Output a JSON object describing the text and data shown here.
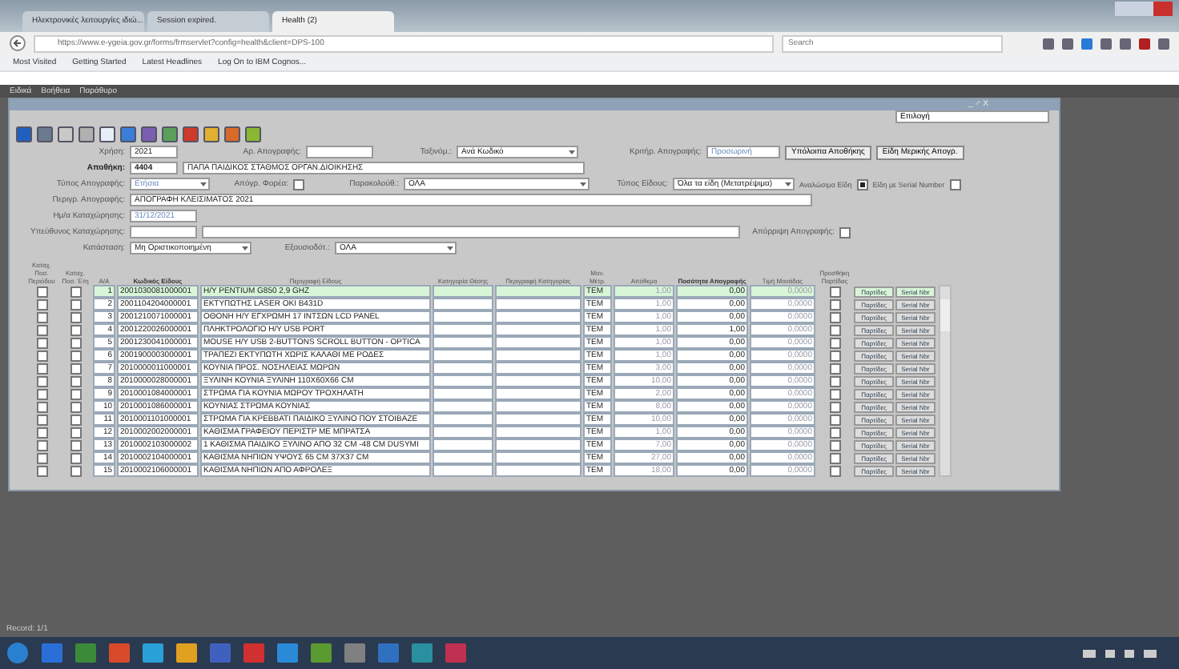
{
  "browser": {
    "tabs": [
      {
        "title": "Ηλεκτρονικές λειτουργίες ιδιώ...",
        "selected": false
      },
      {
        "title": "Session expired.",
        "selected": false
      },
      {
        "title": "Health (2)",
        "selected": true
      }
    ],
    "url": "https://www.e-ygeia.gov.gr/forms/frmservlet?config=health&client=DPS-100",
    "search_placeholder": "Search",
    "bookmarks": [
      "Most Visited",
      "Getting Started",
      "Latest Headlines",
      "Log On to IBM Cognos..."
    ]
  },
  "menu": [
    "Ειδικά",
    "Βοήθεια",
    "Παράθυρο"
  ],
  "form": {
    "title_controls": "_ ♂ X",
    "selection": "Επιλογή",
    "year": {
      "label": "Χρήση:",
      "value": "2021"
    },
    "inventory_no": {
      "label": "Αρ. Απογραφής:"
    },
    "sort": {
      "label": "Ταξινόμ.:",
      "value": "Ανά Κωδικό"
    },
    "inventory_criterion": {
      "label": "Κριτήρ. Απογραφής:",
      "placeholder": "Προσωρινή"
    },
    "buttons": [
      "Υπόλοιπα Αποθήκης",
      "Είδη Μερικής Απογρ."
    ],
    "warehouse": {
      "label": "Αποθήκη:",
      "code": "4404",
      "name": "ΠΑΠΑ ΠΑΙΔΙΚΟΣ ΣΤΑΘΜΟΣ ΟΡΓΑΝ.ΔΙΟΙΚΗΣΗΣ"
    },
    "inventory_type": {
      "label": "Τύπος Απογραφής:",
      "placeholder": "Ετήσια"
    },
    "body_inventory": {
      "label": "Απόγρ. Φορέα:",
      "checked": false
    },
    "monitoring": {
      "label": "Παρακολούθ.:",
      "value": "ΟΛΑ"
    },
    "item_type": {
      "label": "Τύπος Είδους:",
      "value": "Όλα τα είδη (Μετατρέψιμα)"
    },
    "consumables": {
      "label": "Αναλώσιμα Είδη",
      "checked": true
    },
    "serial_items": {
      "label": "Είδη με Serial Number",
      "checked": false
    },
    "description": {
      "label": "Περιγρ. Απογραφής:",
      "value": "ΑΠΟΓΡΑΦΗ ΚΛΕΙΣΙΜΑΤΟΣ 2021"
    },
    "entry_date": {
      "label": "Ημ/α Καταχώρησης:",
      "placeholder": "31/12/2021"
    },
    "responsible": {
      "label": "Υπεύθυνος Καταχώρησης:"
    },
    "rejection": {
      "label": "Απόρριψη Απογραφής:",
      "checked": false
    },
    "status": {
      "label": "Κατάσταση:",
      "value": "Μη Οριστικοποιημένη"
    },
    "authorization": {
      "label": "Εξουσιοδότ.:",
      "value": "ΟΛΑ"
    }
  },
  "table": {
    "columns": [
      "Καταχ. Ποσ. Περιόδου",
      "Καταχ. Ποσ. Έτη",
      "Α/Α",
      "Κωδικός Είδους",
      "Περιγραφή Είδους",
      "Κατηγορία Θέσης",
      "Περιγραφή Κατηγορίας",
      "Μον. Μέτρ.",
      "Απόθεμα",
      "Ποσότητα Απογραφής",
      "Τιμή Μονάδας",
      "Προσθήκη Παρτίδας"
    ],
    "rows": [
      {
        "selected": true,
        "check_a": false,
        "check_b": false,
        "no": "1",
        "code": "2001030081000001",
        "desc": "Η/Υ PENTIUM G850 2,9 GHZ",
        "unit": "TEM",
        "stock": "1,00",
        "qty": "0,00",
        "price": "0,0000",
        "lot": false,
        "buttons": [
          "Παρτίδες",
          "Serial Nbr"
        ]
      },
      {
        "selected": false,
        "check_a": false,
        "check_b": false,
        "no": "2",
        "code": "2001104204000001",
        "desc": "ΕΚΤΥΠΩΤΗΣ LASER OKI B431D",
        "unit": "TEM",
        "stock": "1,00",
        "qty": "0,00",
        "price": "0,0000",
        "lot": false,
        "buttons": [
          "Παρτίδες",
          "Serial Nbr"
        ]
      },
      {
        "selected": false,
        "check_a": false,
        "check_b": false,
        "no": "3",
        "code": "2001210071000001",
        "desc": "ΟΘΟΝΗ Η/Υ ΕΓΧΡΩΜΗ 17 ΙΝΤΣΩΝ LCD PANEL",
        "unit": "TEM",
        "stock": "1,00",
        "qty": "0,00",
        "price": "0,0000",
        "lot": false,
        "buttons": [
          "Παρτίδες",
          "Serial Nbr"
        ]
      },
      {
        "selected": false,
        "check_a": false,
        "check_b": false,
        "no": "4",
        "code": "2001220026000001",
        "desc": "ΠΛΗΚΤΡΟΛΟΓΙΟ Η/Υ USB PORT",
        "unit": "TEM",
        "stock": "1,00",
        "qty": "1,00",
        "price": "0,0000",
        "lot": false,
        "buttons": [
          "Παρτίδες",
          "Serial Nbr"
        ]
      },
      {
        "selected": false,
        "check_a": false,
        "check_b": false,
        "no": "5",
        "code": "2001230041000001",
        "desc": "MOUSE Η/Υ USB 2-BUTTONS  SCROLL BUTTON - OPTICA",
        "unit": "TEM",
        "stock": "1,00",
        "qty": "0,00",
        "price": "0,0000",
        "lot": false,
        "buttons": [
          "Παρτίδες",
          "Serial Nbr"
        ]
      },
      {
        "selected": false,
        "check_a": false,
        "check_b": false,
        "no": "6",
        "code": "2001900003000001",
        "desc": "ΤΡΑΠΕΖΙ ΕΚΤΥΠΩΤΗ ΧΩΡΙΣ ΚΑΛΑΘΙ ΜΕ ΡΟΔΕΣ",
        "unit": "TEM",
        "stock": "1,00",
        "qty": "0,00",
        "price": "0,0000",
        "lot": false,
        "buttons": [
          "Παρτίδες",
          "Serial Nbr"
        ]
      },
      {
        "selected": false,
        "check_a": false,
        "check_b": false,
        "no": "7",
        "code": "2010000011000001",
        "desc": "ΚΟΥΝΙΑ ΠΡΟΣ. ΝΟΣΗΛΕΙΑΣ ΜΩΡΩΝ",
        "unit": "TEM",
        "stock": "3,00",
        "qty": "0,00",
        "price": "0,0000",
        "lot": false,
        "buttons": [
          "Παρτίδες",
          "Serial Nbr"
        ]
      },
      {
        "selected": false,
        "check_a": false,
        "check_b": false,
        "no": "8",
        "code": "2010000028000001",
        "desc": "ΞΥΛΙΝΗ ΚΟΥΝΙΑ ΞΥΛΙΝΗ 110Χ60Χ66 CM",
        "unit": "TEM",
        "stock": "10,00",
        "qty": "0,00",
        "price": "0,0000",
        "lot": false,
        "buttons": [
          "Παρτίδες",
          "Serial Nbr"
        ]
      },
      {
        "selected": false,
        "check_a": false,
        "check_b": false,
        "no": "9",
        "code": "2010001084000001",
        "desc": "ΣΤΡΩΜΑ ΓΙΑ ΚΟΥΝΙΑ ΜΩΡΟΥ ΤΡΟΧΗΛΑΤΗ",
        "unit": "TEM",
        "stock": "2,00",
        "qty": "0,00",
        "price": "0,0000",
        "lot": false,
        "buttons": [
          "Παρτίδες",
          "Serial Nbr"
        ]
      },
      {
        "selected": false,
        "check_a": false,
        "check_b": false,
        "no": "10",
        "code": "2010001086000001",
        "desc": "ΚΟΥΝΙΑΣ ΣΤΡΩΜΑ ΚΟΥΝΙΑΣ",
        "unit": "TEM",
        "stock": "8,00",
        "qty": "0,00",
        "price": "0,0000",
        "lot": false,
        "buttons": [
          "Παρτίδες",
          "Serial Nbr"
        ]
      },
      {
        "selected": false,
        "check_a": false,
        "check_b": false,
        "no": "11",
        "code": "2010001101000001",
        "desc": "ΣΤΡΩΜΑ ΓΙΑ ΚΡΕΒΒΑΤΙ ΠΑΙΔΙΚΟ ΞΥΛΙΝΟ ΠΟΥ ΣΤΟΙΒΑΖΕ",
        "unit": "TEM",
        "stock": "10,00",
        "qty": "0,00",
        "price": "0,0000",
        "lot": false,
        "buttons": [
          "Παρτίδες",
          "Serial Nbr"
        ]
      },
      {
        "selected": false,
        "check_a": false,
        "check_b": false,
        "no": "12",
        "code": "2010002002000001",
        "desc": "ΚΑΘΙΣΜΑ ΓΡΑΦΕΙΟΥ ΠΕΡΙΣΤΡ ΜΕ ΜΠΡΑΤΣΑ",
        "unit": "TEM",
        "stock": "1,00",
        "qty": "0,00",
        "price": "0,0000",
        "lot": false,
        "buttons": [
          "Παρτίδες",
          "Serial Nbr"
        ]
      },
      {
        "selected": false,
        "check_a": false,
        "check_b": false,
        "no": "13",
        "code": "2010002103000002",
        "desc": "1 ΚΑΘΙΣΜΑ ΠΑΙΔΙΚΟ ΞΥΛΙΝΟ ΑΠΟ 32 CM -48 CM DUSYMI",
        "unit": "TEM",
        "stock": "7,00",
        "qty": "0,00",
        "price": "0,0000",
        "lot": false,
        "buttons": [
          "Παρτίδες",
          "Serial Nbr"
        ]
      },
      {
        "selected": false,
        "check_a": false,
        "check_b": false,
        "no": "14",
        "code": "2010002104000001",
        "desc": "ΚΑΘΙΣΜΑ ΝΗΠΙΩΝ ΥΨΟΥΣ 65 CM 37Χ37 CM",
        "unit": "TEM",
        "stock": "27,00",
        "qty": "0,00",
        "price": "0,0000",
        "lot": false,
        "buttons": [
          "Παρτίδες",
          "Serial Nbr"
        ]
      },
      {
        "selected": false,
        "check_a": false,
        "check_b": false,
        "no": "15",
        "code": "2010002106000001",
        "desc": "ΚΑΘΙΣΜΑ ΝΗΠΙΩΝ ΑΠΟ ΑΦΡΟΛΕΞ",
        "unit": "TEM",
        "stock": "18,00",
        "qty": "0,00",
        "price": "0,0000",
        "lot": false,
        "buttons": [
          "Παρτίδες",
          "Serial Nbr"
        ]
      }
    ]
  },
  "status_bar": {
    "record": "Record: 1/1"
  }
}
